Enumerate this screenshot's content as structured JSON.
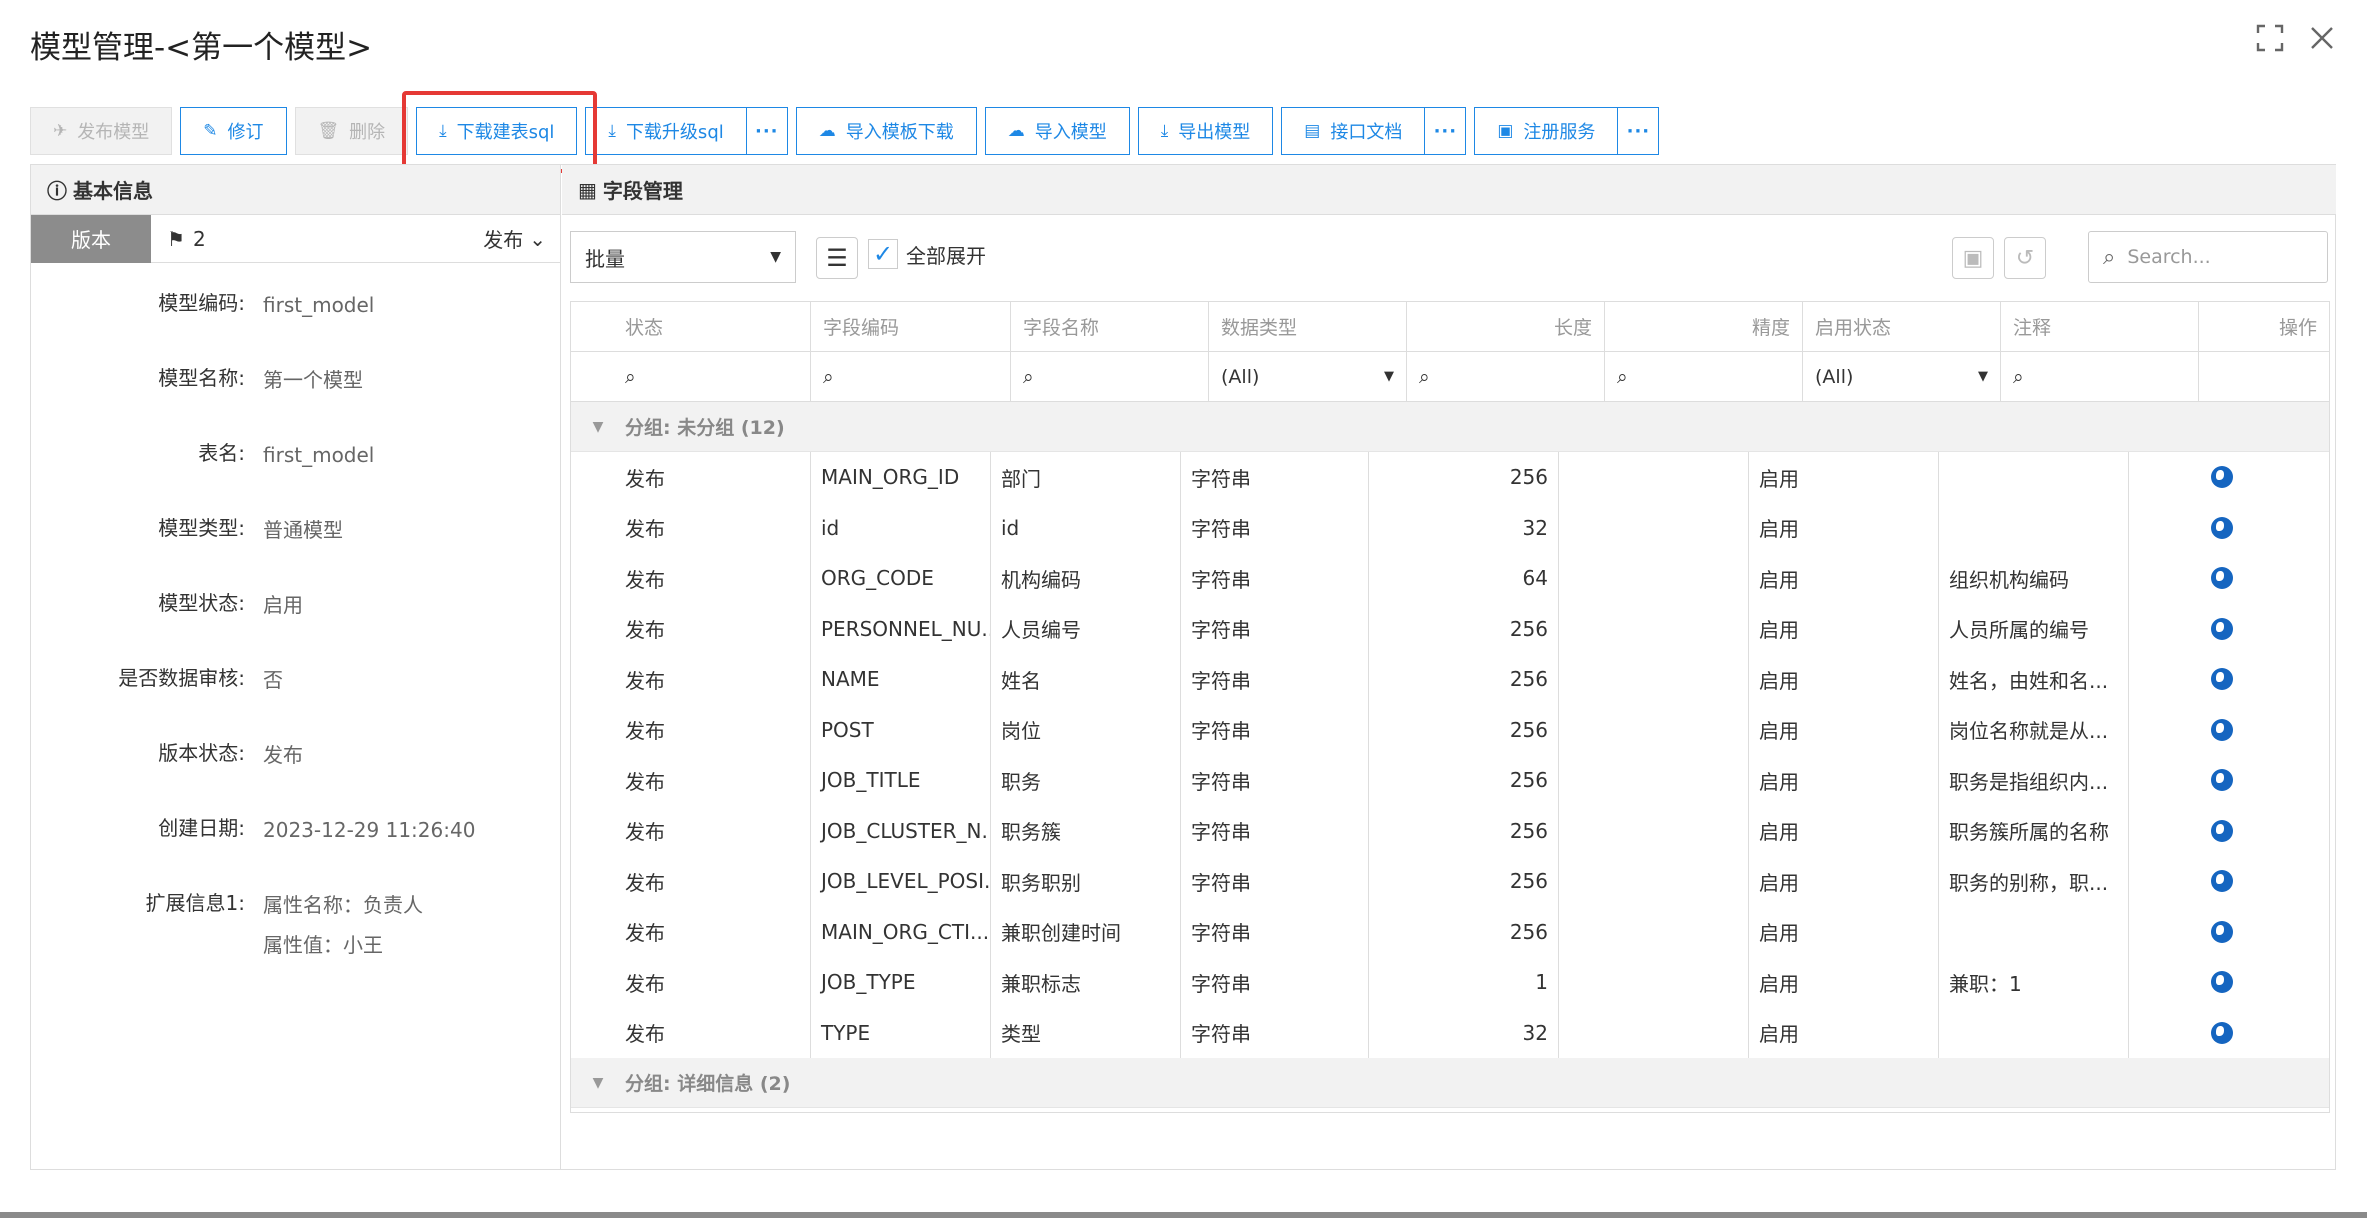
{
  "dialog": {
    "title": "模型管理-<第一个模型>"
  },
  "toolbar": {
    "buttons": [
      {
        "label": "发布模型",
        "icon": "paper-plane-icon",
        "disabled": true
      },
      {
        "label": "修订",
        "icon": "edit-icon",
        "disabled": false
      },
      {
        "label": "删除",
        "icon": "trash-icon",
        "disabled": true
      },
      {
        "label": "下载建表sql",
        "icon": "download-icon",
        "disabled": false
      },
      {
        "label": "下载升级sql",
        "icon": "download-icon",
        "disabled": false
      },
      {
        "label": "导入模板下载",
        "icon": "cloud-download-icon",
        "disabled": false
      },
      {
        "label": "导入模型",
        "icon": "cloud-upload-icon",
        "disabled": false
      },
      {
        "label": "导出模型",
        "icon": "download-icon",
        "disabled": false
      },
      {
        "label": "接口文档",
        "icon": "document-icon",
        "disabled": false
      },
      {
        "label": "注册服务",
        "icon": "register-icon",
        "disabled": false
      }
    ],
    "more_label": "···"
  },
  "left": {
    "title": "基本信息",
    "version_tab": "版本",
    "version_number": "2",
    "version_status": "发布",
    "fields": [
      {
        "label": "模型编码:",
        "value": "first_model"
      },
      {
        "label": "模型名称:",
        "value": "第一个模型"
      },
      {
        "label": "表名:",
        "value": "first_model"
      },
      {
        "label": "模型类型:",
        "value": "普通模型"
      },
      {
        "label": "模型状态:",
        "value": "启用"
      },
      {
        "label": "是否数据审核:",
        "value": "否"
      },
      {
        "label": "版本状态:",
        "value": "发布"
      },
      {
        "label": "创建日期:",
        "value": "2023-12-29 11:26:40"
      }
    ],
    "ext_label": "扩展信息1:",
    "ext_line1": "属性名称：负责人",
    "ext_line2": "属性值：小王"
  },
  "right": {
    "title": "字段管理",
    "batch_label": "批量",
    "expand_all_label": "全部展开",
    "search_placeholder": "Search...",
    "columns": [
      "状态",
      "字段编码",
      "字段名称",
      "数据类型",
      "长度",
      "精度",
      "启用状态",
      "注释",
      "操作"
    ],
    "filter_all": "(All)",
    "group1": "分组: 未分组 (12)",
    "group2": "分组: 详细信息 (2)",
    "rows": [
      {
        "status": "发布",
        "code": "MAIN_ORG_ID",
        "name": "部门",
        "type": "字符串",
        "length": "256",
        "enabled": "启用",
        "comment": ""
      },
      {
        "status": "发布",
        "code": "id",
        "name": "id",
        "type": "字符串",
        "length": "32",
        "enabled": "启用",
        "comment": ""
      },
      {
        "status": "发布",
        "code": "ORG_CODE",
        "name": "机构编码",
        "type": "字符串",
        "length": "64",
        "enabled": "启用",
        "comment": "组织机构编码"
      },
      {
        "status": "发布",
        "code": "PERSONNEL_NU...",
        "name": "人员编号",
        "type": "字符串",
        "length": "256",
        "enabled": "启用",
        "comment": "人员所属的编号"
      },
      {
        "status": "发布",
        "code": "NAME",
        "name": "姓名",
        "type": "字符串",
        "length": "256",
        "enabled": "启用",
        "comment": "姓名，由姓和名..."
      },
      {
        "status": "发布",
        "code": "POST",
        "name": "岗位",
        "type": "字符串",
        "length": "256",
        "enabled": "启用",
        "comment": "岗位名称就是从..."
      },
      {
        "status": "发布",
        "code": "JOB_TITLE",
        "name": "职务",
        "type": "字符串",
        "length": "256",
        "enabled": "启用",
        "comment": "职务是指组织内..."
      },
      {
        "status": "发布",
        "code": "JOB_CLUSTER_N...",
        "name": "职务簇",
        "type": "字符串",
        "length": "256",
        "enabled": "启用",
        "comment": "职务簇所属的名称"
      },
      {
        "status": "发布",
        "code": "JOB_LEVEL_POSI...",
        "name": "职务职别",
        "type": "字符串",
        "length": "256",
        "enabled": "启用",
        "comment": "职务的别称，职..."
      },
      {
        "status": "发布",
        "code": "MAIN_ORG_CTI...",
        "name": "兼职创建时间",
        "type": "字符串",
        "length": "256",
        "enabled": "启用",
        "comment": ""
      },
      {
        "status": "发布",
        "code": "JOB_TYPE",
        "name": "兼职标志",
        "type": "字符串",
        "length": "1",
        "enabled": "启用",
        "comment": "兼职：1"
      },
      {
        "status": "发布",
        "code": "TYPE",
        "name": "类型",
        "type": "字符串",
        "length": "32",
        "enabled": "启用",
        "comment": ""
      }
    ]
  },
  "colors": {
    "accent": "#1e88e5",
    "highlight": "#e53935",
    "tab_bg": "#8c8c8c"
  }
}
